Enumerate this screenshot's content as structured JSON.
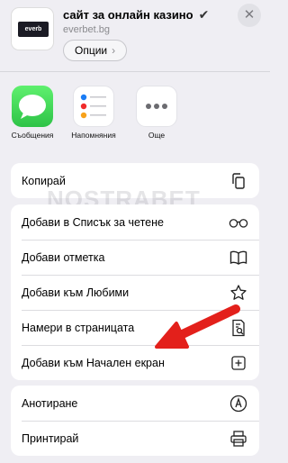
{
  "header": {
    "thumbnail_brand": "everb",
    "title": "сайт за онлайн казино",
    "title_check": "✔",
    "subtitle": "everbet.bg",
    "options_label": "Опции",
    "options_chevron": "›",
    "close_label": "✕"
  },
  "apps": [
    {
      "label": "Съобщения",
      "icon": "messages-icon"
    },
    {
      "label": "Напомняния",
      "icon": "reminders-icon"
    },
    {
      "label": "Още",
      "icon": "more-icon"
    }
  ],
  "watermark": "NOSTRABET",
  "group1": [
    {
      "label": "Копирай",
      "icon": "copy-icon"
    }
  ],
  "group2": [
    {
      "label": "Добави в Списък за четене",
      "icon": "glasses-icon"
    },
    {
      "label": "Добави отметка",
      "icon": "book-icon"
    },
    {
      "label": "Добави към Любими",
      "icon": "star-icon"
    },
    {
      "label": "Намери в страницата",
      "icon": "find-on-page-icon"
    },
    {
      "label": "Добави към Начален екран",
      "icon": "add-square-icon"
    }
  ],
  "group3": [
    {
      "label": "Анотиране",
      "icon": "markup-icon"
    },
    {
      "label": "Принтирай",
      "icon": "printer-icon"
    }
  ],
  "colors": {
    "background": "#efeef3",
    "arrow": "#e3201b",
    "messages_green": "#34c759"
  }
}
